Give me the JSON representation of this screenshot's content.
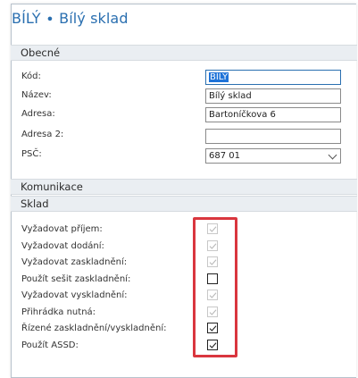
{
  "page": {
    "title": "BÍLÝ ∙ Bílý sklad"
  },
  "sections": {
    "obecne": "Obecné",
    "komunikace": "Komunikace",
    "sklad": "Sklad"
  },
  "general": {
    "kod_label": "Kód:",
    "kod_value": "BÍLÝ",
    "nazev_label": "Název:",
    "nazev_value": "Bílý sklad",
    "adresa_label": "Adresa:",
    "adresa_value": "Bartoníčkova 6",
    "adresa2_label": "Adresa 2:",
    "adresa2_value": "",
    "psc_label": "PSČ:",
    "psc_value": "687 01"
  },
  "warehouse": {
    "items": [
      {
        "label": "Vyžadovat příjem:",
        "checked": true,
        "enabled": false
      },
      {
        "label": "Vyžadovat dodání:",
        "checked": true,
        "enabled": false
      },
      {
        "label": "Vyžadovat zaskladnění:",
        "checked": true,
        "enabled": false
      },
      {
        "label": "Použít sešit zaskladnění:",
        "checked": false,
        "enabled": true
      },
      {
        "label": "Vyžadovat vyskladnění:",
        "checked": true,
        "enabled": false
      },
      {
        "label": "Přihrádka nutná:",
        "checked": true,
        "enabled": false
      },
      {
        "label": "Řízené zaskladnění/vyskladnění:",
        "checked": true,
        "enabled": true
      },
      {
        "label": "Použít ASSD:",
        "checked": true,
        "enabled": true
      }
    ]
  },
  "colors": {
    "title": "#2a6fb0",
    "highlight": "#d9363e",
    "section_bg": "#eaeef2",
    "selection": "#1e73d8"
  }
}
